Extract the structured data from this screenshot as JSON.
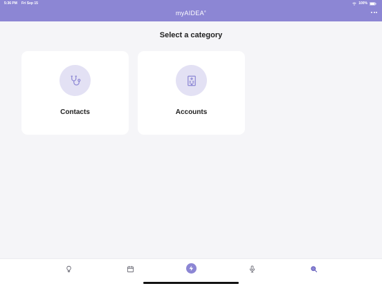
{
  "status_bar": {
    "time": "5:36 PM",
    "date": "Fri Sep 15",
    "battery": "100%",
    "icons": [
      "wifi-icon",
      "battery-icon"
    ]
  },
  "header": {
    "title": "myAIDEA",
    "trademark": "®",
    "menu_icon": "more-icon",
    "color": "#8c86d4"
  },
  "main": {
    "title": "Select a category",
    "categories": [
      {
        "label": "Contacts",
        "icon": "stethoscope-icon"
      },
      {
        "label": "Accounts",
        "icon": "hospital-icon"
      }
    ],
    "icon_background": "#e3e1f4",
    "icon_color": "#8c86d4"
  },
  "tab_bar": {
    "tabs": [
      {
        "icon": "lightbulb-icon"
      },
      {
        "icon": "calendar-icon"
      },
      {
        "icon": "lightning-icon",
        "active": true
      },
      {
        "icon": "microphone-icon"
      },
      {
        "icon": "search-icon",
        "accent": true
      }
    ]
  }
}
